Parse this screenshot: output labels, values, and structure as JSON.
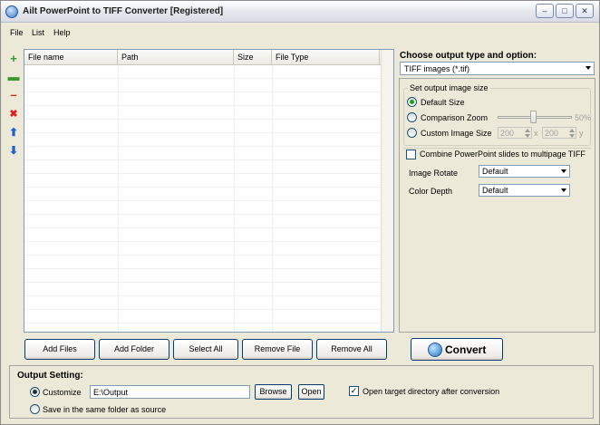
{
  "window": {
    "title": "Ailt PowerPoint to TIFF Converter [Registered]"
  },
  "window_controls": {
    "minimize": "–",
    "maximize": "□",
    "close": "✕"
  },
  "menu": [
    "File",
    "List",
    "Help"
  ],
  "toolbar_icons": [
    {
      "name": "add-icon",
      "glyph": "+",
      "color": "#2e9a2e"
    },
    {
      "name": "folder-icon",
      "glyph": "▬",
      "color": "#3d9a2e"
    },
    {
      "name": "remove-icon",
      "glyph": "–",
      "color": "#d81e1e"
    },
    {
      "name": "delete-icon",
      "glyph": "✖",
      "color": "#d81e1e"
    },
    {
      "name": "arrow-up-icon",
      "glyph": "⬆",
      "color": "#2060d0"
    },
    {
      "name": "arrow-down-icon",
      "glyph": "⬇",
      "color": "#2060d0"
    }
  ],
  "file_list": {
    "columns": [
      "File name",
      "Path",
      "Size",
      "File Type"
    ]
  },
  "buttons": {
    "add_files": "Add Files",
    "add_folder": "Add Folder",
    "select_all": "Select All",
    "remove_file": "Remove File",
    "remove_all": "Remove All",
    "convert": "Convert"
  },
  "output_type": {
    "title": "Choose output type and option:",
    "selected": "TIFF images (*.tif)"
  },
  "image_size": {
    "group_label": "Set output image size",
    "default_size": "Default Size",
    "comparison_zoom": "Comparison Zoom",
    "zoom_value": "50%",
    "custom_size": "Custom Image Size",
    "width": "200",
    "x_label": "x",
    "height": "200",
    "y_label": "y"
  },
  "combine": {
    "label": "Combine PowerPoint slides to multipage TIFF",
    "checked": false
  },
  "image_rotate": {
    "label": "Image Rotate",
    "value": "Default"
  },
  "color_depth": {
    "label": "Color Depth",
    "value": "Default"
  },
  "output_setting": {
    "title": "Output Setting:",
    "customize_label": "Customize",
    "path": "E:\\Output",
    "browse": "Browse",
    "open": "Open",
    "open_dir_label": "Open target directory after conversion",
    "open_dir_checked": "✓",
    "same_folder_label": "Save in the same folder as source"
  }
}
